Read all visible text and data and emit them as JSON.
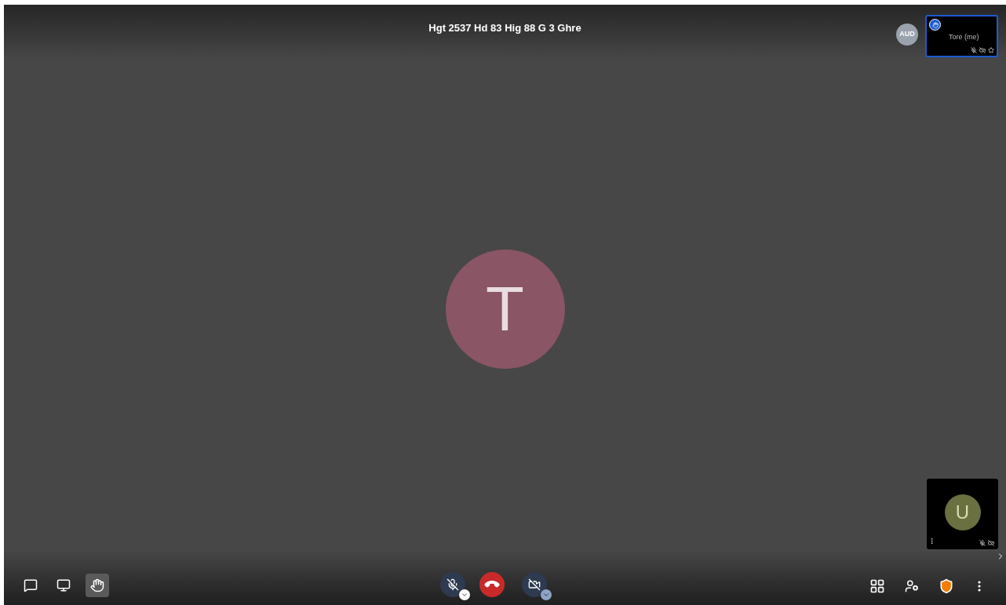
{
  "meeting": {
    "title": "Hgt 2537 Hd 83 Hig 88 G 3 Ghre"
  },
  "main_participant": {
    "initial": "T",
    "color": "#8a5565"
  },
  "filmstrip": {
    "audio_badge": "AUD",
    "self": {
      "name": "Tore (me)",
      "hand_raised": true,
      "muted": true,
      "video_off": true,
      "selected": true
    },
    "remote": {
      "initial": "U",
      "color": "#6b7040",
      "muted": true,
      "video_off": true
    }
  },
  "toolbar": {
    "hand_raised": true,
    "mic_muted": true,
    "camera_off": true
  }
}
